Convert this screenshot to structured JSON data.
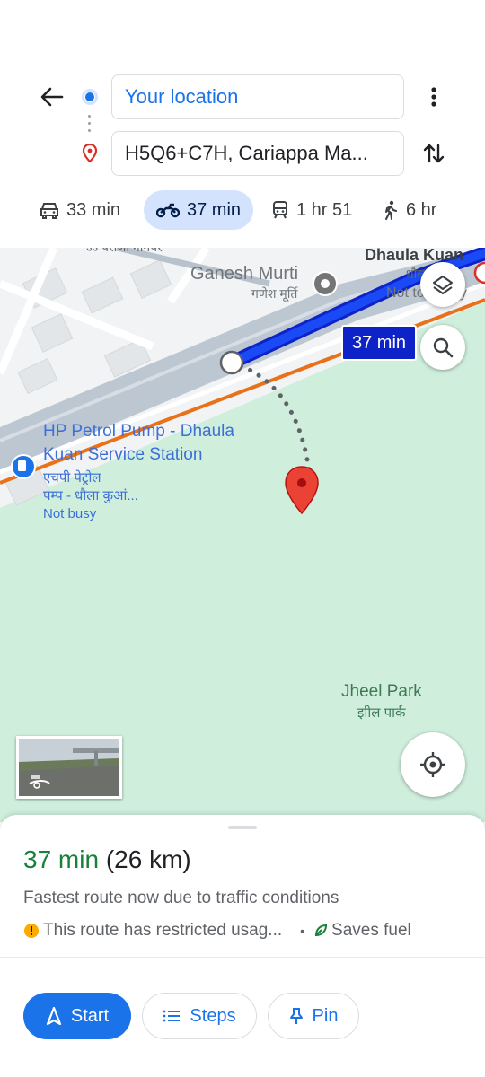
{
  "header": {
    "origin_value": "Your location",
    "destination_value": "H5Q6+C7H, Cariappa Ma...",
    "modes": [
      {
        "label": "33 min",
        "icon": "car-icon",
        "active": false
      },
      {
        "label": "37 min",
        "icon": "motorcycle-icon",
        "active": true
      },
      {
        "label": "1 hr 51",
        "icon": "transit-icon",
        "active": false
      },
      {
        "label": "6 hr",
        "icon": "walk-icon",
        "active": false
      }
    ]
  },
  "map": {
    "labels": {
      "top_partial": "ऽऽ पराणा गानपर",
      "dhaula_kuan": "Dhaula Kuan",
      "dhaula_kuan_hi": "धौला कुआँ",
      "ganesh_murti": "Ganesh Murti",
      "ganesh_murti_hi": "गणेश मूर्ति",
      "not_busy_top": "Not too busy",
      "hp_line1": "HP Petrol Pump - Dhaula",
      "hp_line2": "Kuan Service Station",
      "hp_hi_line1": "एचपी पेट्रोल",
      "hp_hi_line2": "पम्प - धौला कुआं...",
      "not_busy": "Not busy",
      "jheel_park": "Jheel Park",
      "jheel_park_hi": "झील पार्क"
    },
    "route_tag": "37 min",
    "colors": {
      "route": "#1a2ef0",
      "park": "#cfeedc",
      "traffic": "#e8711a"
    }
  },
  "sheet": {
    "eta_time": "37 min",
    "eta_distance": "(26 km)",
    "reason": "Fastest route now due to traffic conditions",
    "restriction": "This route has restricted usag...",
    "separator": "•",
    "fuel": "Saves fuel",
    "buttons": {
      "start": "Start",
      "steps": "Steps",
      "pin": "Pin"
    }
  }
}
